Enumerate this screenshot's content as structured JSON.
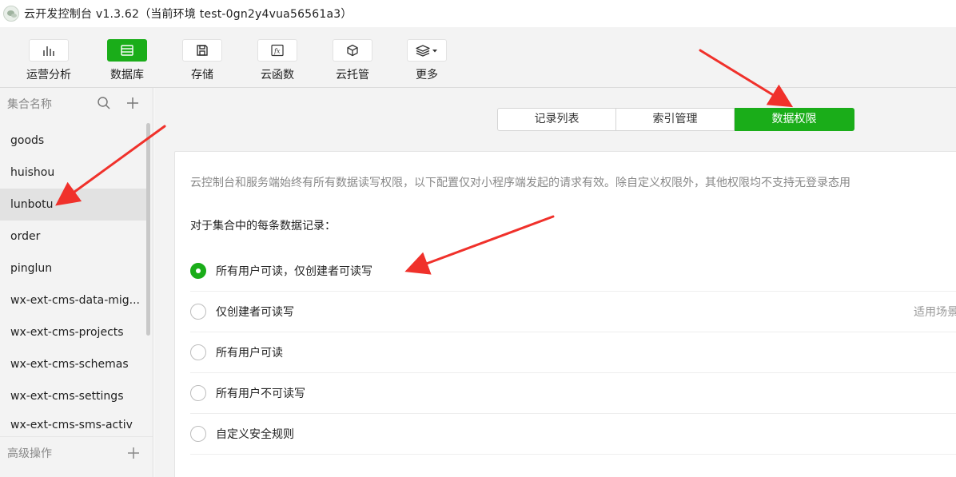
{
  "window": {
    "title": "云开发控制台 v1.3.62（当前环境 test-0gn2y4vua56561a3）"
  },
  "toolbar": {
    "items": [
      {
        "label": "运营分析",
        "icon": "bar-chart-icon"
      },
      {
        "label": "数据库",
        "icon": "database-icon",
        "active": true
      },
      {
        "label": "存储",
        "icon": "storage-icon"
      },
      {
        "label": "云函数",
        "icon": "function-icon"
      },
      {
        "label": "云托管",
        "icon": "cube-icon"
      },
      {
        "label": "更多",
        "icon": "layers-icon"
      }
    ]
  },
  "sidebar": {
    "header": "集合名称",
    "collections": [
      "goods",
      "huishou",
      "lunbotu",
      "order",
      "pinglun",
      "wx-ext-cms-data-mig...",
      "wx-ext-cms-projects",
      "wx-ext-cms-schemas",
      "wx-ext-cms-settings",
      "wx-ext-cms-sms-activ"
    ],
    "active_collection": "lunbotu",
    "footer": "高级操作"
  },
  "tabs": [
    {
      "label": "记录列表"
    },
    {
      "label": "索引管理"
    },
    {
      "label": "数据权限",
      "active": true
    }
  ],
  "permissions": {
    "description": "云控制台和服务端始终有所有数据读写权限，以下配置仅对小程序端发起的请求有效。除自定义权限外，其他权限均不支持无登录态用",
    "subheading": "对于集合中的每条数据记录：",
    "options": [
      {
        "label": "所有用户可读，仅创建者可读写",
        "checked": true,
        "hint": ""
      },
      {
        "label": "仅创建者可读写",
        "checked": false,
        "hint": "适用场景"
      },
      {
        "label": "所有用户可读",
        "checked": false,
        "hint": ""
      },
      {
        "label": "所有用户不可读写",
        "checked": false,
        "hint": ""
      },
      {
        "label": "自定义安全规则",
        "checked": false,
        "hint": ""
      }
    ]
  },
  "colors": {
    "accent": "#1aad19",
    "annotation_arrow": "#f0312b"
  }
}
